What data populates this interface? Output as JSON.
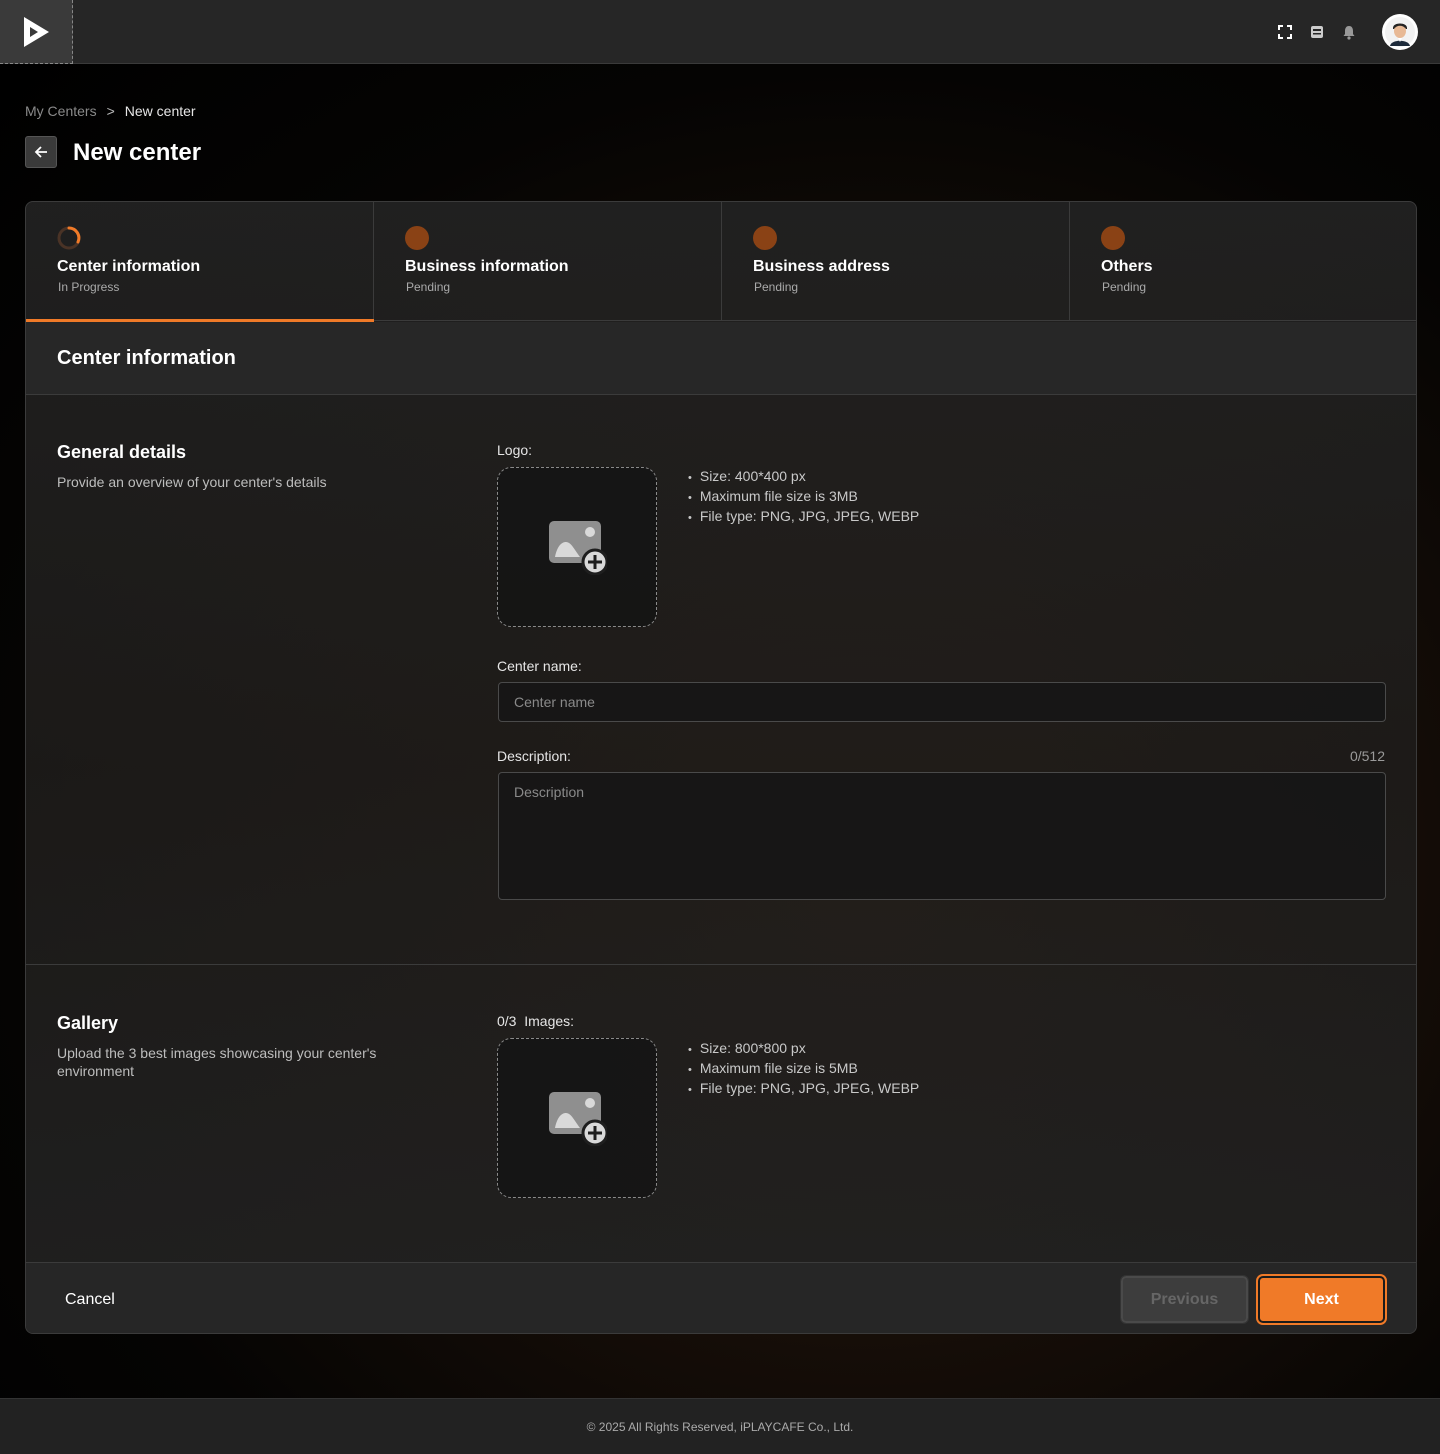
{
  "header": {
    "icons": [
      "fullscreen-icon",
      "inbox-icon",
      "bell-icon"
    ],
    "avatar": "user-avatar"
  },
  "breadcrumb": {
    "parent": "My Centers",
    "separator": ">",
    "current": "New center"
  },
  "page": {
    "title": "New center"
  },
  "steps": [
    {
      "title": "Center information",
      "status": "In Progress"
    },
    {
      "title": "Business information",
      "status": "Pending"
    },
    {
      "title": "Business address",
      "status": "Pending"
    },
    {
      "title": "Others",
      "status": "Pending"
    }
  ],
  "section": {
    "title": "Center information"
  },
  "general": {
    "title": "General details",
    "description": "Provide an overview of your center's details",
    "logo_label": "Logo:",
    "logo_hints": [
      "Size: 400*400 px",
      "Maximum file size is 3MB",
      "File type: PNG, JPG, JPEG, WEBP"
    ],
    "center_name_label": "Center name:",
    "center_name_placeholder": "Center name",
    "center_name_value": "",
    "description_label": "Description:",
    "description_counter": "0/512",
    "description_placeholder": "Description",
    "description_value": ""
  },
  "gallery": {
    "title": "Gallery",
    "description": "Upload the 3 best images showcasing your center's environment",
    "images_label": "0/3  Images:",
    "hints": [
      "Size: 800*800 px",
      "Maximum file size is 5MB",
      "File type: PNG, JPG, JPEG, WEBP"
    ]
  },
  "actions": {
    "cancel": "Cancel",
    "previous": "Previous",
    "next": "Next"
  },
  "colors": {
    "accent": "#f07a28",
    "pending_dot": "#8a4215"
  },
  "footer": {
    "copyright": "© 2025 All Rights Reserved, iPLAYCAFE Co., Ltd."
  }
}
